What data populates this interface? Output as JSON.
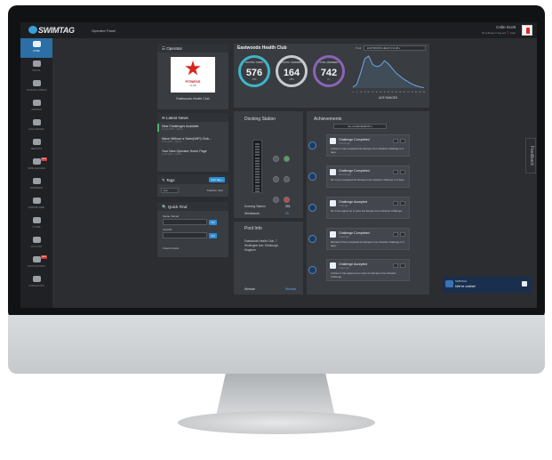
{
  "app": {
    "logo_text": "SWIMTAG",
    "panel_title": "Operator Panel",
    "user_name": "Colin Scott",
    "user_links": "⚙ settings  ⏻ log out  ❓ help"
  },
  "sidebar": {
    "items": [
      {
        "label": "HOME",
        "icon": "home-icon",
        "active": true
      },
      {
        "label": "SOCIAL",
        "icon": "chat-icon"
      },
      {
        "label": "TRAINING VIDEOS",
        "icon": "play-icon"
      },
      {
        "label": "AWARDS",
        "icon": "trophy-icon"
      },
      {
        "label": "CHALLENGES",
        "icon": "medal-icon"
      },
      {
        "label": "REPORTS",
        "icon": "chart-icon"
      },
      {
        "label": "SWIM LEAGUES",
        "icon": "list-icon",
        "badge": "NEW"
      },
      {
        "label": "SWIMMERS",
        "icon": "people-icon"
      },
      {
        "label": "SWIMTRAINER",
        "icon": "pen-icon"
      },
      {
        "label": "STORE",
        "icon": "cart-icon"
      },
      {
        "label": "ACCOUNT",
        "icon": "lock-icon"
      },
      {
        "label": "NOTIFICATIONS",
        "icon": "inbox-icon",
        "badge": "NEW"
      },
      {
        "label": "DOWNLOADS",
        "icon": "download-icon"
      }
    ]
  },
  "operator": {
    "heading": "Operator",
    "logo_word": "FITNESS",
    "logo_sub": "CLUB",
    "name": "Eastwoods Health Club"
  },
  "news": {
    "heading": "Latest News",
    "items": [
      {
        "title": "New Challenges Available",
        "date": "21 Jan 2017 - Admin"
      },
      {
        "title": "Wave Without a Swim(WiFi) Club...",
        "date": "8 Jan 2017 - Admin"
      },
      {
        "title": "Your New Operator Home Page",
        "date": "4 Jan 2017 - Admin"
      }
    ]
  },
  "tags": {
    "heading": "Tags",
    "add_label": "Add Tag +",
    "input_value": "Epc",
    "value": "Triathlon Club"
  },
  "quick_find": {
    "heading": "Quick Find",
    "name_label": "Name / Email",
    "card_label": "Card ID",
    "go_label": "GO",
    "status": "0 items found"
  },
  "club": {
    "title": "Eastwoods Health Club",
    "pool_label": "Pool:",
    "pool_value": "EASTWOODS HEALTH CLUB ▾",
    "stats": [
      {
        "caption": "MONTHLY SWIMS",
        "value": "576",
        "pct": "17%",
        "color": "#3fb4c8"
      },
      {
        "caption": "MONTHLY SWIMMERS",
        "value": "164",
        "pct": "15%",
        "color": "#c7cbd0"
      },
      {
        "caption": "TOTAL SWIMMERS",
        "value": "742",
        "pct": "4 ↑",
        "color": "#8b63b8"
      }
    ],
    "age_label": "AGE RANGES"
  },
  "chart_data": {
    "type": "area",
    "title": "AGE RANGES",
    "x": [
      "0",
      "5",
      "10",
      "15",
      "20",
      "25",
      "30",
      "35",
      "40",
      "45",
      "50",
      "55",
      "60",
      "65",
      "70",
      "75",
      "80",
      "85",
      "90"
    ],
    "values": [
      2,
      10,
      40,
      75,
      82,
      60,
      55,
      58,
      70,
      62,
      50,
      38,
      30,
      22,
      16,
      10,
      6,
      3,
      1
    ],
    "color": "#6fa8e6"
  },
  "docking": {
    "heading": "Docking Station",
    "rows": [
      {
        "label": "Docking Station",
        "value": "251"
      },
      {
        "label": "Wristbands",
        "value": "25"
      }
    ]
  },
  "pool_info": {
    "heading": "Pool Info",
    "address": "Eastwoods Health Club, 7 Wurlington Ave, Edinburgh, Kingdom",
    "website_label": "Website",
    "website_value": "Website"
  },
  "achievements": {
    "heading": "Achievements",
    "filter": "ALL ACHIEVEMENTS ▾",
    "items": [
      {
        "title": "Challenge Completed",
        "time": "6 hours ago",
        "desc": "Andrew C has completed the Escape From Alcatraz challenge in 3 days."
      },
      {
        "title": "Challenge Completed",
        "time": "20 hours ago",
        "desc": "Mr V has completed the Escape From Alcatraz challenge in 4 days."
      },
      {
        "title": "Challenge Accepted",
        "time": "1 day ago",
        "desc": "Mr V has signed up to swim the Escape From Alcatraz challenge."
      },
      {
        "title": "Challenge Completed",
        "time": "2 days ago",
        "desc": "Michelle P has completed the Escape From Alcatraz challenge in 9 days."
      },
      {
        "title": "Challenge Accepted",
        "time": "3 days ago",
        "desc": "Andrew C has signed up to swim the Escape From Alcatraz challenge."
      }
    ]
  },
  "chat": {
    "brand": "SWIMTAG",
    "status": "We're online!"
  },
  "feedback_label": "Feedback"
}
